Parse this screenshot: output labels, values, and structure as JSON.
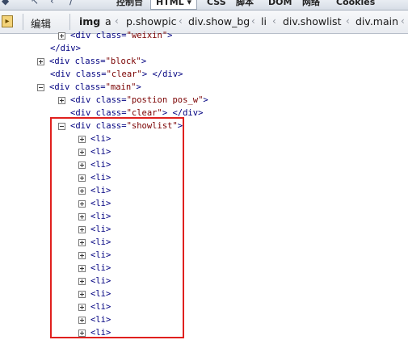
{
  "topbar": {
    "tabs": [
      {
        "label": "控制台"
      },
      {
        "label": "HTML ▾"
      },
      {
        "label": "CSS"
      },
      {
        "label": "脚本"
      },
      {
        "label": "DOM"
      },
      {
        "label": "网络"
      },
      {
        "label": "Cookies"
      }
    ],
    "active_tab": "HTML"
  },
  "breadcrumb": {
    "edit_label": "编辑",
    "crumbs": [
      "img",
      "a",
      "p.showpic",
      "div.show_bg",
      "li",
      "div.showlist",
      "div.main"
    ],
    "current": "img"
  },
  "tree": {
    "rows": [
      {
        "open": "<div",
        "attr": "class=",
        "value": "\"weixin\"",
        "close": ">"
      },
      {
        "text": "</div>"
      },
      {
        "open": "<div",
        "attr": "class=",
        "value": "\"block\"",
        "close": ">"
      },
      {
        "open": "<div",
        "attr": "class=",
        "value": "\"clear\"",
        "close": "> </div>"
      },
      {
        "open": "<div",
        "attr": "class=",
        "value": "\"main\"",
        "close": ">"
      },
      {
        "open": "<div",
        "attr": "class=",
        "value": "\"postion pos_w\"",
        "close": ">"
      },
      {
        "open": "<div",
        "attr": "class=",
        "value": "\"clear\"",
        "close": "> </div>"
      },
      {
        "open": "<div",
        "attr": "class=",
        "value": "\"showlist\"",
        "close": ">"
      }
    ],
    "li_label": "<li>",
    "li_count": 16
  },
  "colors": {
    "highlight_border": "#e0201e",
    "tag_color": "#000080",
    "value_color": "#7a0000"
  }
}
